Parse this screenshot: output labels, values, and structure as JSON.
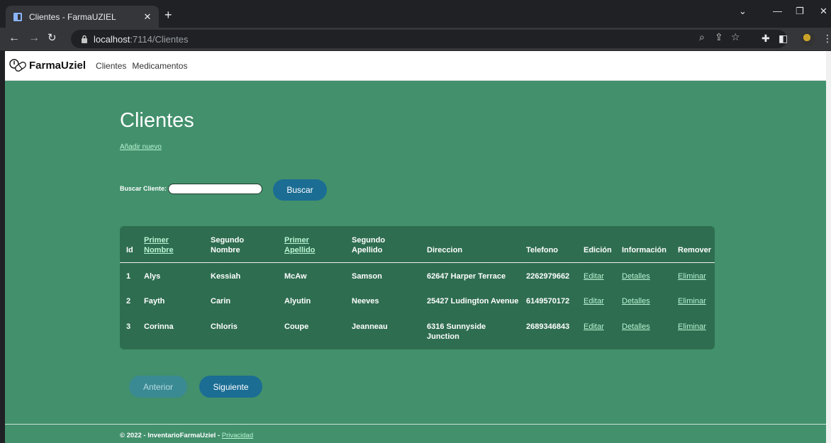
{
  "browser": {
    "tab_title": "Clientes - FarmaUZIEL",
    "url_host": "localhost",
    "url_path": ":7114/Clientes",
    "new_tab_glyph": "+",
    "close_tab_glyph": "✕"
  },
  "nav": {
    "brand": "FarmaUziel",
    "links": [
      "Clientes",
      "Medicamentos"
    ]
  },
  "page": {
    "title": "Clientes",
    "add_new": "Añadir nuevo",
    "search_label": "Buscar Cliente:",
    "search_value": "",
    "search_button": "Buscar"
  },
  "table": {
    "headers": {
      "id": "Id",
      "primer_nombre_1": "Primer",
      "primer_nombre_2": "Nombre",
      "segundo_nombre_1": "Segundo",
      "segundo_nombre_2": "Nombre",
      "primer_apellido_1": "Primer",
      "primer_apellido_2": "Apellido",
      "segundo_apellido_1": "Segundo",
      "segundo_apellido_2": "Apellido",
      "direccion": "Direccion",
      "telefono": "Telefono",
      "edicion": "Edición",
      "informacion": "Información",
      "remover": "Remover"
    },
    "rows": [
      {
        "id": "1",
        "primer_nombre": "Alys",
        "segundo_nombre": "Kessiah",
        "primer_apellido": "McAw",
        "segundo_apellido": "Samson",
        "direccion": "62647 Harper Terrace",
        "telefono": "2262979662",
        "editar": "Editar",
        "detalles": "Detalles",
        "eliminar": "Eliminar"
      },
      {
        "id": "2",
        "primer_nombre": "Fayth",
        "segundo_nombre": "Carin",
        "primer_apellido": "Alyutin",
        "segundo_apellido": "Neeves",
        "direccion": "25427 Ludington Avenue",
        "telefono": "6149570172",
        "editar": "Editar",
        "detalles": "Detalles",
        "eliminar": "Eliminar"
      },
      {
        "id": "3",
        "primer_nombre": "Corinna",
        "segundo_nombre": "Chloris",
        "primer_apellido": "Coupe",
        "segundo_apellido": "Jeanneau",
        "direccion": "6316 Sunnyside Junction",
        "telefono": "2689346843",
        "editar": "Editar",
        "detalles": "Detalles",
        "eliminar": "Eliminar"
      }
    ]
  },
  "pagination": {
    "prev": "Anterior",
    "next": "Siguiente"
  },
  "footer": {
    "text": "© 2022 - InventarioFarmaUziel - ",
    "link": "Privacidad"
  },
  "colors": {
    "page_bg": "#42906c",
    "table_bg": "#2e6d50",
    "button_primary": "#1b6d94",
    "link": "#b9f3d3"
  }
}
